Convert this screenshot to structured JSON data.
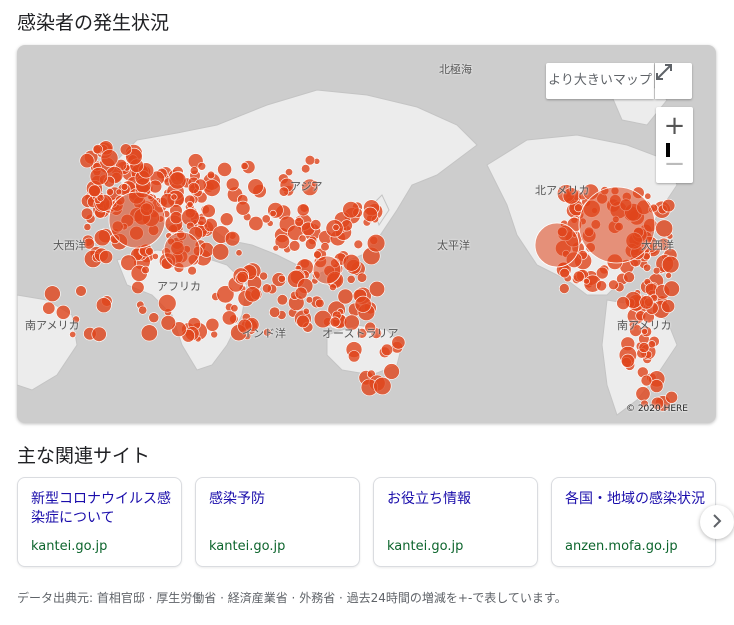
{
  "title": "感染者の発生状況",
  "map": {
    "labels": {
      "arctic": "北極海",
      "asia": "アジア",
      "north_america": "北アメリカ",
      "atlantic_w": "大西洋",
      "atlantic_e": "大西洋",
      "pacific": "太平洋",
      "africa": "アフリカ",
      "south_america_w": "南アメリカ",
      "south_america_e": "南アメリカ",
      "indian_ocean": "インド洋",
      "australia": "オーストラリア"
    },
    "copyright": "© 2020 HERE",
    "larger_map_label": "より大きいマップ",
    "expand_icon": "expand-icon",
    "zoom_in": "+",
    "zoom_out": "−",
    "marker_color": "#e0451c"
  },
  "related_title": "主な関連サイト",
  "cards": [
    {
      "title": "新型コロナウイルス感染症について",
      "site": "kantei.go.jp"
    },
    {
      "title": "感染予防",
      "site": "kantei.go.jp"
    },
    {
      "title": "お役立ち情報",
      "site": "kantei.go.jp"
    },
    {
      "title": "各国・地域の感染状況",
      "site": "anzen.mofa.go.jp"
    }
  ],
  "next_icon": "chevron-right-icon",
  "footer": "データ出典元: 首相官邸 · 厚生労働省 · 経済産業省 · 外務省 · 過去24時間の増減を+-で表しています。"
}
